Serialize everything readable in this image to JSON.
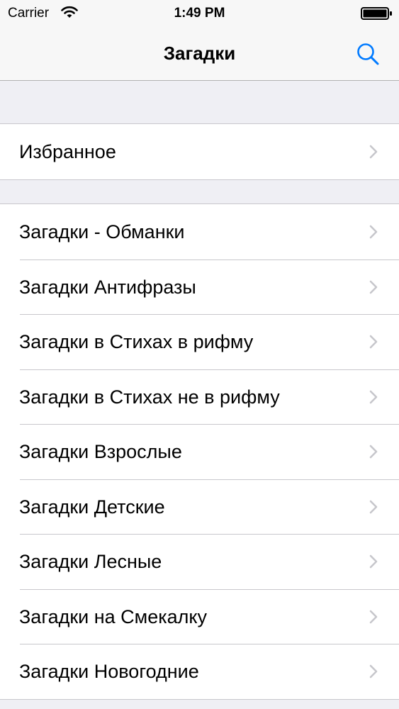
{
  "status_bar": {
    "carrier": "Carrier",
    "time": "1:49 PM",
    "icons": [
      "wifi-icon",
      "battery-icon"
    ]
  },
  "nav_bar": {
    "title": "Загадки",
    "search_icon": "search-icon"
  },
  "favorites": {
    "label": "Избранное"
  },
  "categories": [
    {
      "label": "Загадки - Обманки"
    },
    {
      "label": "Загадки Антифразы"
    },
    {
      "label": "Загадки в Стихах в рифму"
    },
    {
      "label": "Загадки в Стихах не в рифму"
    },
    {
      "label": "Загадки Взрослые"
    },
    {
      "label": "Загадки Детские"
    },
    {
      "label": "Загадки Лесные"
    },
    {
      "label": "Загадки на Смекалку"
    },
    {
      "label": "Загадки Новогодние"
    }
  ],
  "colors": {
    "accent": "#007aff",
    "bar_background": "#f7f7f7",
    "group_background": "#efeff4",
    "separator": "#c8c7cc",
    "chevron": "#c7c7cc"
  }
}
